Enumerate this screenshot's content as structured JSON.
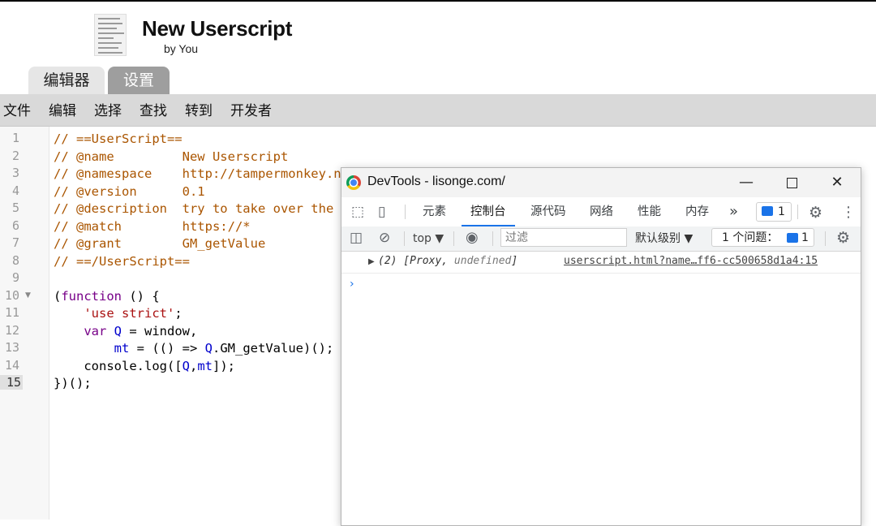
{
  "header": {
    "title": "New Userscript",
    "byline": "by You"
  },
  "tabs": [
    {
      "label": "编辑器",
      "active": false
    },
    {
      "label": "设置",
      "active": true
    }
  ],
  "menu": [
    "文件",
    "编辑",
    "选择",
    "查找",
    "转到",
    "开发者"
  ],
  "editor": {
    "line_numbers": [
      "1",
      "2",
      "3",
      "4",
      "5",
      "6",
      "7",
      "8",
      "9",
      "10",
      "11",
      "12",
      "13",
      "14",
      "15"
    ],
    "active_line": "15",
    "lines": {
      "l1": "// ==UserScript==",
      "l2": "// @name         New Userscript",
      "l3": "// @namespace    http://tampermonkey.net/",
      "l4": "// @version      0.1",
      "l5": "// @description  try to take over the world!",
      "l6": "// @match        https://*",
      "l7": "// @grant        GM_getValue",
      "l8": "// ==/UserScript==",
      "l10_kw": "function",
      "l11_str": "'use strict'",
      "l12_kw": "var",
      "l12_var": "Q",
      "l12_rest": " = window,",
      "l13_var1": "mt",
      "l13_rest1": " = (() => ",
      "l13_var2": "Q",
      "l13_rest2": ".GM_getValue)();",
      "l14_pre": "console.log([",
      "l14_v1": "Q",
      "l14_v2": "mt",
      "l14_post": "]);",
      "l15": "})();"
    }
  },
  "devtools": {
    "title": "DevTools - lisonge.com/",
    "tabs": [
      "元素",
      "控制台",
      "源代码",
      "网络",
      "性能",
      "内存"
    ],
    "active_tab": "控制台",
    "more": "»",
    "issue_count": "1",
    "console": {
      "context": "top",
      "filter_placeholder": "过滤",
      "levels": "默认级别",
      "issues_label": "1 个问题：",
      "issues_count": "1",
      "log_text_main": "(2) [Proxy, ",
      "log_text_undef": "undefined",
      "log_text_end": "]",
      "log_source": "userscript.html?name…ff6-cc500658d1a4:15",
      "prompt": "›"
    }
  },
  "colors": {
    "comment": "#aa5500",
    "keyword": "#770088",
    "string": "#aa1111",
    "variable": "#0000cc",
    "devtools_accent": "#1a73e8"
  }
}
